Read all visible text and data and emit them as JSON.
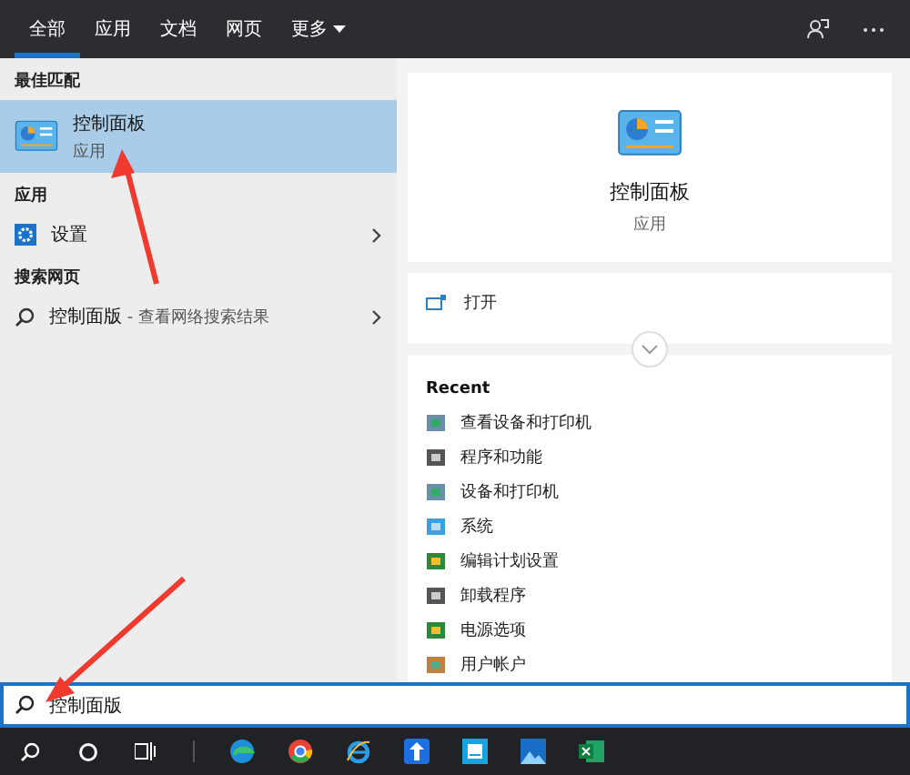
{
  "tabs": [
    {
      "label": "全部",
      "selected": true,
      "kind": "plain"
    },
    {
      "label": "应用",
      "selected": false,
      "kind": "plain"
    },
    {
      "label": "文档",
      "selected": false,
      "kind": "plain"
    },
    {
      "label": "网页",
      "selected": false,
      "kind": "plain"
    },
    {
      "label": "更多",
      "selected": false,
      "kind": "dropdown"
    }
  ],
  "results": [
    {
      "heading": "最佳匹配",
      "items": [
        {
          "kind": "best",
          "title": "控制面板",
          "subtitle": "应用",
          "selected": true
        }
      ]
    },
    {
      "heading": "应用",
      "items": [
        {
          "kind": "app",
          "title": "设置",
          "selected": false
        }
      ]
    },
    {
      "heading": "搜索网页",
      "items": [
        {
          "kind": "web",
          "title": "控制面版",
          "suffix": " - 查看网络搜索结果",
          "selected": false
        }
      ]
    }
  ],
  "preview": {
    "title": "控制面板",
    "subtitle": "应用",
    "actions": [
      "打开"
    ],
    "recent_heading": "Recent",
    "recent": [
      {
        "label": "查看设备和打印机",
        "kind": "devices"
      },
      {
        "label": "程序和功能",
        "kind": "programs"
      },
      {
        "label": "设备和打印机",
        "kind": "devices"
      },
      {
        "label": "系统",
        "kind": "system"
      },
      {
        "label": "编辑计划设置",
        "kind": "power"
      },
      {
        "label": "卸载程序",
        "kind": "programs"
      },
      {
        "label": "电源选项",
        "kind": "power"
      },
      {
        "label": "用户帐户",
        "kind": "users"
      }
    ]
  },
  "search": {
    "value": "控制面版"
  }
}
